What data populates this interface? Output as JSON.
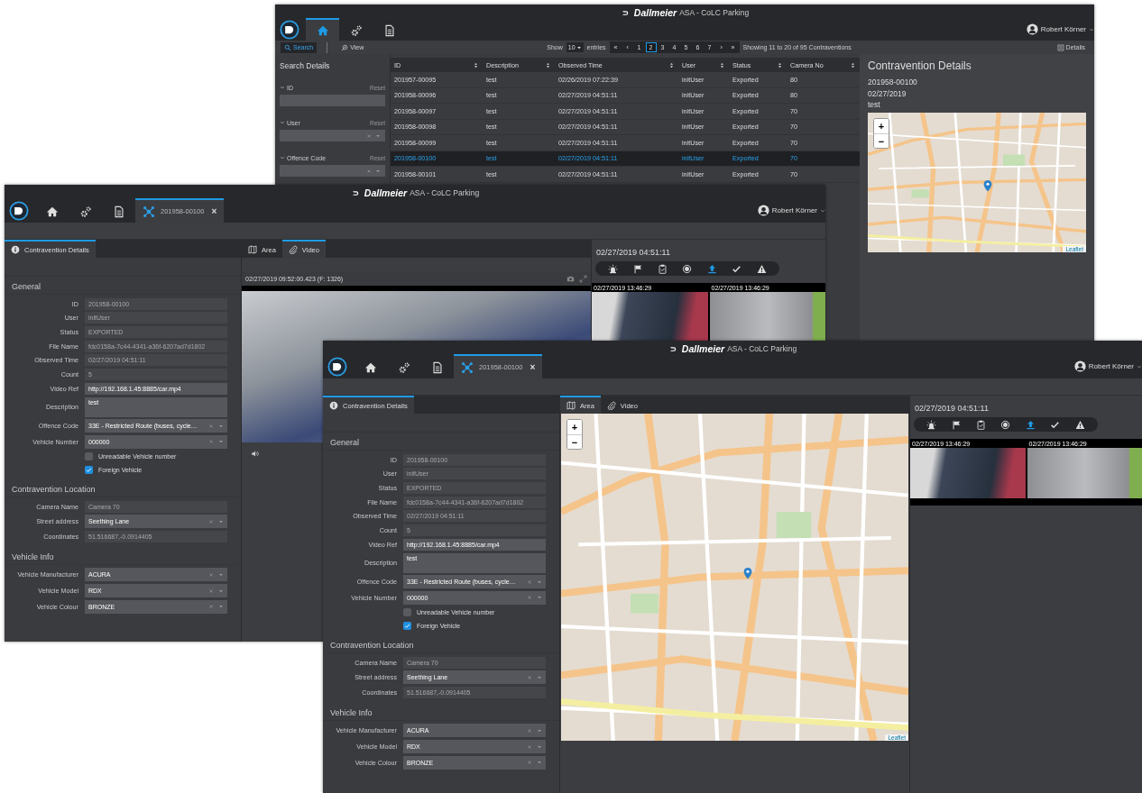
{
  "windows": [
    {
      "kind": "list",
      "brand": "Dallmeier",
      "title": "ASA - CoLC Parking",
      "user": "Robert Körner",
      "nav": [
        {
          "kind": "home",
          "selected": true
        },
        {
          "kind": "gears",
          "selected": false
        },
        {
          "kind": "document",
          "selected": false
        }
      ],
      "toolbar": {
        "search": {
          "label": "Search",
          "selected": true
        },
        "view": {
          "label": "View",
          "selected": false
        },
        "show_label": "Show",
        "page_size": "10",
        "entries_label": "entries",
        "pages": [
          {
            "label": "«",
            "selected": false
          },
          {
            "label": "‹",
            "selected": false
          },
          {
            "label": "1",
            "selected": false
          },
          {
            "label": "2",
            "selected": true
          },
          {
            "label": "3",
            "selected": false
          },
          {
            "label": "4",
            "selected": false
          },
          {
            "label": "5",
            "selected": false
          },
          {
            "label": "6",
            "selected": false
          },
          {
            "label": "7",
            "selected": false
          },
          {
            "label": "›",
            "selected": false
          },
          {
            "label": "»",
            "selected": false
          }
        ],
        "summary": "Showing 11 to 20 of 95 Contraventions",
        "details": "Details"
      },
      "sidebar": {
        "title": "Search Details",
        "filters": [
          {
            "kind": "text",
            "label": "ID",
            "reset": "Reset"
          },
          {
            "kind": "select",
            "label": "User",
            "reset": "Reset"
          },
          {
            "kind": "select",
            "label": "Offence Code",
            "reset": "Reset"
          }
        ]
      },
      "table": {
        "columns": [
          "ID",
          "Description",
          "Observed Time",
          "User",
          "Status",
          "Camera No"
        ],
        "rows": [
          {
            "cells": [
              "201957-00095",
              "test",
              "02/26/2019 07:22:39",
              "initUser",
              "Exported",
              "80"
            ],
            "selected": false
          },
          {
            "cells": [
              "201958-00096",
              "test",
              "02/27/2019 04:51:11",
              "initUser",
              "Exported",
              "80"
            ],
            "selected": false
          },
          {
            "cells": [
              "201958-00097",
              "test",
              "02/27/2019 04:51:11",
              "initUser",
              "Exported",
              "70"
            ],
            "selected": false
          },
          {
            "cells": [
              "201958-00098",
              "test",
              "02/27/2019 04:51:11",
              "initUser",
              "Exported",
              "70"
            ],
            "selected": false
          },
          {
            "cells": [
              "201958-00099",
              "test",
              "02/27/2019 04:51:11",
              "initUser",
              "Exported",
              "70"
            ],
            "selected": false
          },
          {
            "cells": [
              "201958-00100",
              "test",
              "02/27/2019 04:51:11",
              "initUser",
              "Exported",
              "70"
            ],
            "selected": true
          },
          {
            "cells": [
              "201958-00101",
              "test",
              "02/27/2019 04:51:11",
              "initUser",
              "Exported",
              "70"
            ],
            "selected": false
          }
        ]
      },
      "details": {
        "title": "Contravention Details",
        "lines": [
          "201958-00100",
          "02/27/2019",
          "test"
        ],
        "map": {
          "zoom_in": "+",
          "zoom_out": "−",
          "attribution": "Leaflet"
        }
      }
    },
    {
      "kind": "detail",
      "brand": "Dallmeier",
      "title": "ASA - CoLC Parking",
      "user": "Robert Körner",
      "nav": [
        {
          "kind": "home",
          "selected": false
        },
        {
          "kind": "gears",
          "selected": false
        },
        {
          "kind": "document",
          "selected": false
        }
      ],
      "record_tab": {
        "label": "201958-00100",
        "close": "×",
        "selected": true
      },
      "panel_tab": {
        "label": "Contravention Details",
        "selected": true
      },
      "sections": [
        {
          "title": "General",
          "fields": [
            {
              "kind": "readonly",
              "label": "ID",
              "value": "201958-00100"
            },
            {
              "kind": "readonly",
              "label": "User",
              "value": "initUser"
            },
            {
              "kind": "readonly",
              "label": "Status",
              "value": "EXPORTED"
            },
            {
              "kind": "readonly",
              "label": "File Name",
              "value": "fdc0158a-7c44-4341-a36f-6207ad7d1802"
            },
            {
              "kind": "readonly",
              "label": "Observed Time",
              "value": "02/27/2019 04:51:11"
            },
            {
              "kind": "readonly",
              "label": "Count",
              "value": "5"
            },
            {
              "kind": "input",
              "label": "Video Ref",
              "value": "http://192.168.1.45:8885/car.mp4"
            },
            {
              "kind": "textarea",
              "label": "Description",
              "value": "test"
            },
            {
              "kind": "select",
              "label": "Offence Code",
              "value": "33E - Restricted Route (buses, cycle…"
            },
            {
              "kind": "select",
              "label": "Vehicle Number",
              "value": "000000"
            },
            {
              "kind": "checkbox",
              "label": "Unreadable Vehicle number",
              "checked": false
            },
            {
              "kind": "checkbox",
              "label": "Foreign Vehicle",
              "checked": true
            }
          ]
        },
        {
          "title": "Contravention Location",
          "fields": [
            {
              "kind": "readonly",
              "label": "Camera Name",
              "value": "Camera 70"
            },
            {
              "kind": "select",
              "label": "Street address",
              "value": "Seething Lane"
            },
            {
              "kind": "readonly",
              "label": "Coordinates",
              "value": "51.516687,-0.0914405"
            }
          ]
        },
        {
          "title": "Vehicle Info",
          "fields": [
            {
              "kind": "select",
              "label": "Vehicle Manufacturer",
              "value": "ACURA"
            },
            {
              "kind": "select",
              "label": "Vehicle Model",
              "value": "RDX"
            },
            {
              "kind": "select",
              "label": "Vehicle Colour",
              "value": "BRONZE"
            }
          ]
        }
      ],
      "media_tabs": [
        {
          "kind": "area",
          "label": "Area",
          "selected": false
        },
        {
          "kind": "video",
          "label": "Video",
          "selected": true
        }
      ],
      "video": {
        "timestamp": "02/27/2019 09:52:00.423 (F: 1326)"
      },
      "observed": "02/27/2019 04:51:11",
      "actions": [
        {
          "kind": "siren",
          "selected": false
        },
        {
          "kind": "flag",
          "selected": false
        },
        {
          "kind": "clipboard",
          "selected": false
        },
        {
          "kind": "record",
          "selected": false
        },
        {
          "kind": "upload",
          "selected": true
        },
        {
          "kind": "check",
          "selected": false
        },
        {
          "kind": "warning",
          "selected": false
        }
      ],
      "snapshots": [
        {
          "timestamp": "02/27/2019 13:46:29"
        },
        {
          "timestamp": "02/27/2019 13:46:29"
        }
      ]
    },
    {
      "kind": "detail",
      "brand": "Dallmeier",
      "title": "ASA - CoLC Parking",
      "user": "Robert Körner",
      "nav": [
        {
          "kind": "home",
          "selected": false
        },
        {
          "kind": "gears",
          "selected": false
        },
        {
          "kind": "document",
          "selected": false
        }
      ],
      "record_tab": {
        "label": "201958-00100",
        "close": "×",
        "selected": true
      },
      "panel_tab": {
        "label": "Contravention Details",
        "selected": true
      },
      "sections": [
        {
          "title": "General",
          "fields": [
            {
              "kind": "readonly",
              "label": "ID",
              "value": "201958-00100"
            },
            {
              "kind": "readonly",
              "label": "User",
              "value": "initUser"
            },
            {
              "kind": "readonly",
              "label": "Status",
              "value": "EXPORTED"
            },
            {
              "kind": "readonly",
              "label": "File Name",
              "value": "fdc0158a-7c44-4341-a36f-6207ad7d1802"
            },
            {
              "kind": "readonly",
              "label": "Observed Time",
              "value": "02/27/2019 04:51:11"
            },
            {
              "kind": "readonly",
              "label": "Count",
              "value": "5"
            },
            {
              "kind": "input",
              "label": "Video Ref",
              "value": "http://192.168.1.45:8885/car.mp4"
            },
            {
              "kind": "textarea",
              "label": "Description",
              "value": "test"
            },
            {
              "kind": "select",
              "label": "Offence Code",
              "value": "33E - Restricted Route (buses, cycle…"
            },
            {
              "kind": "select",
              "label": "Vehicle Number",
              "value": "000000"
            },
            {
              "kind": "checkbox",
              "label": "Unreadable Vehicle number",
              "checked": false
            },
            {
              "kind": "checkbox",
              "label": "Foreign Vehicle",
              "checked": true
            }
          ]
        },
        {
          "title": "Contravention Location",
          "fields": [
            {
              "kind": "readonly",
              "label": "Camera Name",
              "value": "Camera 70"
            },
            {
              "kind": "select",
              "label": "Street address",
              "value": "Seething Lane"
            },
            {
              "kind": "readonly",
              "label": "Coordinates",
              "value": "51.516687,-0.0914405"
            }
          ]
        },
        {
          "title": "Vehicle Info",
          "fields": [
            {
              "kind": "select",
              "label": "Vehicle Manufacturer",
              "value": "ACURA"
            },
            {
              "kind": "select",
              "label": "Vehicle Model",
              "value": "RDX"
            },
            {
              "kind": "select",
              "label": "Vehicle Colour",
              "value": "BRONZE"
            }
          ]
        }
      ],
      "media_tabs": [
        {
          "kind": "area",
          "label": "Area",
          "selected": true
        },
        {
          "kind": "video",
          "label": "Video",
          "selected": false
        }
      ],
      "map": {
        "zoom_in": "+",
        "zoom_out": "−",
        "attribution": "Leaflet"
      },
      "observed": "02/27/2019 04:51:11",
      "actions": [
        {
          "kind": "siren",
          "selected": false
        },
        {
          "kind": "flag",
          "selected": false
        },
        {
          "kind": "clipboard",
          "selected": false
        },
        {
          "kind": "record",
          "selected": false
        },
        {
          "kind": "upload",
          "selected": true
        },
        {
          "kind": "check",
          "selected": false
        },
        {
          "kind": "warning",
          "selected": false
        }
      ],
      "snapshots": [
        {
          "timestamp": "02/27/2019 13:46:29"
        },
        {
          "timestamp": "02/27/2019 13:46:29"
        }
      ]
    }
  ]
}
